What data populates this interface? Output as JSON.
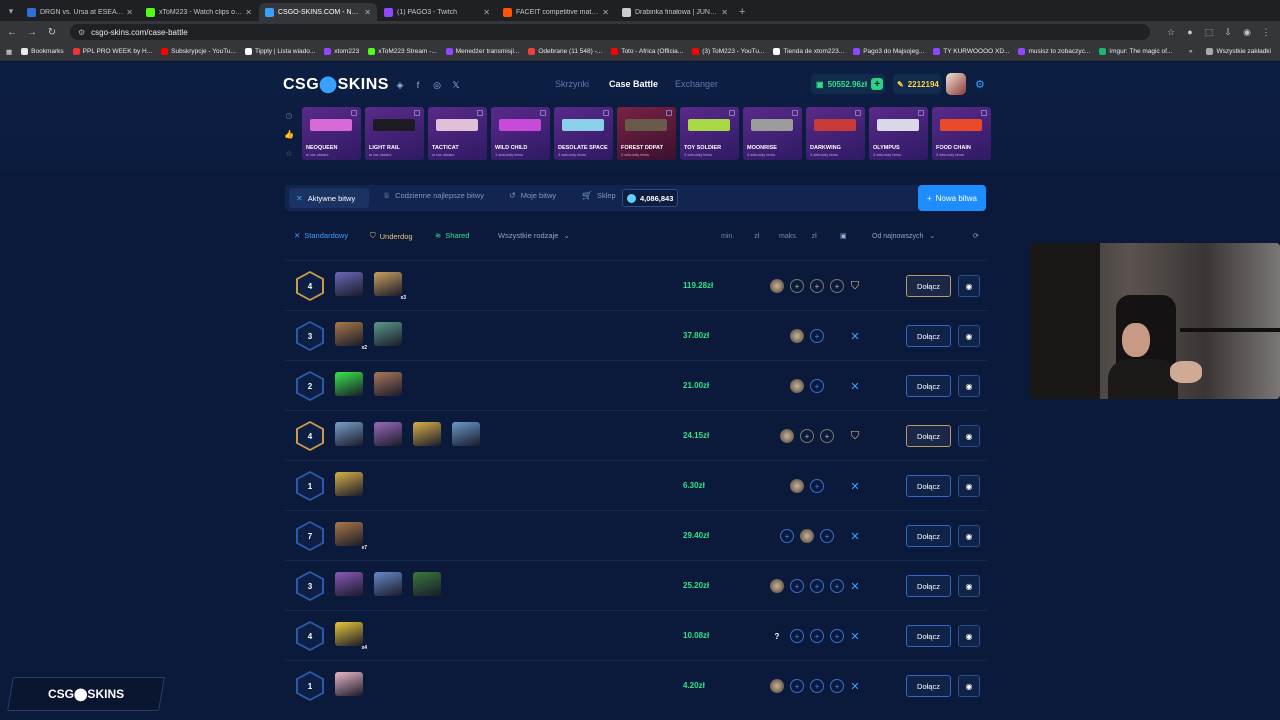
{
  "browser": {
    "tabs": [
      {
        "title": "DRGN vs. Ursa at ESEA Advanced",
        "color": "#2f6fd8",
        "active": false
      },
      {
        "title": "xToM223 - Watch clips on Kick",
        "color": "#53fc18",
        "active": false
      },
      {
        "title": "CSGO-SKINS.COM - Najlepsze",
        "color": "#3aa0ff",
        "active": true
      },
      {
        "title": "(1) PAGO3 - Twitch",
        "color": "#9146ff",
        "active": false
      },
      {
        "title": "FACEIT competitive match - FA",
        "color": "#ff5500",
        "active": false
      },
      {
        "title": "Drabinka finałowa | JUNAJTED",
        "color": "#cccccc",
        "active": false
      }
    ],
    "url": "csgo-skins.com/case-battle",
    "bookmarks": [
      {
        "label": "Bookmarks",
        "color": "#e8eaed"
      },
      {
        "label": "PPL PRO WEEK by H...",
        "color": "#e33"
      },
      {
        "label": "Subskrypcje - YouTu...",
        "color": "#f00"
      },
      {
        "label": "Tipply | Lista wiado...",
        "color": "#fff"
      },
      {
        "label": "xtom223",
        "color": "#9146ff"
      },
      {
        "label": "xToM223 Stream -...",
        "color": "#53fc18"
      },
      {
        "label": "Menedżer transmisji...",
        "color": "#9146ff"
      },
      {
        "label": "Odebrane (11 548) -...",
        "color": "#ea4335"
      },
      {
        "label": "Toto - Africa (Officia...",
        "color": "#f00"
      },
      {
        "label": "(3) ToM223 - YouTu...",
        "color": "#f00"
      },
      {
        "label": "Tienda de xtom223...",
        "color": "#fff"
      },
      {
        "label": "Pago3 do Majsojeg...",
        "color": "#9146ff"
      },
      {
        "label": "TY KURWOOOO XD...",
        "color": "#9146ff"
      },
      {
        "label": "musisz to zobaczyc...",
        "color": "#9146ff"
      },
      {
        "label": "Imgur: The magic of...",
        "color": "#1bb76e"
      }
    ],
    "bookmarks_all": "Wszystkie zakładki"
  },
  "site": {
    "logo_left": "CSG",
    "logo_o": "⬤",
    "logo_right": "SKINS",
    "nav": [
      "Skrzynki",
      "Case Battle",
      "Exchanger"
    ],
    "balance": "50552.96zł",
    "coins": "2212194",
    "drops": [
      {
        "name": "NEOQUEEN",
        "sub": "w raz otwarć",
        "gun": "#d86ad8",
        "red": false
      },
      {
        "name": "LIGHT RAIL",
        "sub": "w raz otwarć",
        "gun": "#1c1c22",
        "red": false
      },
      {
        "name": "TACTICAT",
        "sub": "w raz otwarć",
        "gun": "#e0c0d8",
        "red": false
      },
      {
        "name": "WILD CHILD",
        "sub": "1 sekundy temu",
        "gun": "#c84ad8",
        "red": false
      },
      {
        "name": "DESOLATE SPACE",
        "sub": "3 sekundy temu",
        "gun": "#8ad0e8",
        "red": false
      },
      {
        "name": "FOREST DDPAT",
        "sub": "2 sekundy temu",
        "gun": "#6a5a4a",
        "red": true
      },
      {
        "name": "TOY SOLDIER",
        "sub": "3 sekundy temu",
        "gun": "#a8d848",
        "red": false
      },
      {
        "name": "MOONRISE",
        "sub": "3 sekundy temu",
        "gun": "#9c9c9c",
        "red": false
      },
      {
        "name": "DARKWING",
        "sub": "3 sekundy temu",
        "gun": "#c83a3a",
        "red": false
      },
      {
        "name": "OLYMPUS",
        "sub": "3 sekundy temu",
        "gun": "#d8d8e8",
        "red": false
      },
      {
        "name": "FOOD CHAIN",
        "sub": "3 sekundy temu",
        "gun": "#e84a2a",
        "red": false
      }
    ]
  },
  "battles": {
    "tabs": [
      "Aktywne bitwy",
      "Codzienne najlepsze bitwy",
      "Moje bitwy",
      "Sklep"
    ],
    "gems": "4,086,843",
    "new_battle": "Nowa bitwa",
    "filters": {
      "standard": "Standardowy",
      "underdog": "Underdog",
      "shared": "Shared",
      "all_types": "Wszystkie rodzaje",
      "min": "min.",
      "max": "maks.",
      "currency": "zł",
      "sort": "Od najnowszych"
    },
    "rows": [
      {
        "rounds": "4",
        "price": "119.28zł",
        "mode": "underdog",
        "join": "Dołącz",
        "cases": [
          {
            "c": "#6a6ab8",
            "m": ""
          },
          {
            "c": "#c8a060",
            "m": "x3"
          }
        ],
        "slots": [
          "user",
          "g",
          "g",
          "g"
        ]
      },
      {
        "rounds": "3",
        "price": "37.80zł",
        "mode": "standard",
        "join": "Dołącz",
        "cases": [
          {
            "c": "#a87848",
            "m": "x2"
          },
          {
            "c": "#5a9a8a",
            "m": ""
          }
        ],
        "slots": [
          "user",
          "e"
        ]
      },
      {
        "rounds": "2",
        "price": "21.00zł",
        "mode": "standard",
        "join": "Dołącz",
        "cases": [
          {
            "c": "#3ae84a",
            "m": ""
          },
          {
            "c": "#a87858",
            "m": ""
          }
        ],
        "slots": [
          "user",
          "e"
        ]
      },
      {
        "rounds": "4",
        "price": "24.15zł",
        "mode": "underdog",
        "join": "Dołącz",
        "cases": [
          {
            "c": "#7aa0c8",
            "m": ""
          },
          {
            "c": "#9a6ab8",
            "m": ""
          },
          {
            "c": "#d8b048",
            "m": ""
          },
          {
            "c": "#6a9ac8",
            "m": ""
          }
        ],
        "slots": [
          "user",
          "g",
          "g"
        ]
      },
      {
        "rounds": "1",
        "price": "6.30zł",
        "mode": "standard",
        "join": "Dołącz",
        "cases": [
          {
            "c": "#d8b048",
            "m": ""
          }
        ],
        "slots": [
          "user",
          "e"
        ]
      },
      {
        "rounds": "7",
        "price": "29.40zł",
        "mode": "standard",
        "join": "Dołącz",
        "cases": [
          {
            "c": "#a87848",
            "m": "x7"
          }
        ],
        "slots": [
          "e",
          "user",
          "e"
        ]
      },
      {
        "rounds": "3",
        "price": "25.20zł",
        "mode": "standard",
        "join": "Dołącz",
        "cases": [
          {
            "c": "#8a5ab8",
            "m": ""
          },
          {
            "c": "#6a8ac8",
            "m": ""
          },
          {
            "c": "#3a7a3a",
            "m": ""
          }
        ],
        "slots": [
          "user",
          "e",
          "e",
          "e"
        ]
      },
      {
        "rounds": "4",
        "price": "10.08zł",
        "mode": "standard",
        "join": "Dołącz",
        "cases": [
          {
            "c": "#e8c838",
            "m": "x4"
          }
        ],
        "slots": [
          "q",
          "e",
          "e",
          "e"
        ]
      },
      {
        "rounds": "1",
        "price": "4.20zł",
        "mode": "standard",
        "join": "Dołącz",
        "cases": [
          {
            "c": "#e8b8c8",
            "m": ""
          }
        ],
        "slots": [
          "user",
          "e",
          "e",
          "e"
        ]
      }
    ]
  },
  "watermark": "CSG⬤SKINS",
  "colors": {
    "accent": "#1d8dff",
    "green": "#2fe38a",
    "gold": "#c89a4a"
  }
}
